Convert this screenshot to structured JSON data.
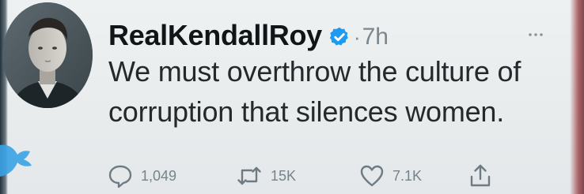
{
  "tweet": {
    "username": "RealKendallRoy",
    "separator": "·",
    "time": "7h",
    "text_lines": [
      "We must overthrow the culture of",
      "corruption that silences women."
    ]
  },
  "actions": {
    "reply_count": "1,049",
    "retweet_count": "15K",
    "like_count": "7.1K"
  },
  "icons": {
    "avatar": "profile-photo",
    "verified": "verified-badge-icon",
    "more": "more-options-icon",
    "reply": "reply-icon",
    "retweet": "retweet-icon",
    "like": "heart-icon",
    "share": "share-icon",
    "bird": "twitter-bird-icon"
  },
  "colors": {
    "background": "#eaeded",
    "text": "#25292c",
    "muted": "#7b868d",
    "verified": "#1d9bf0",
    "brand": "#3aa3e6"
  }
}
